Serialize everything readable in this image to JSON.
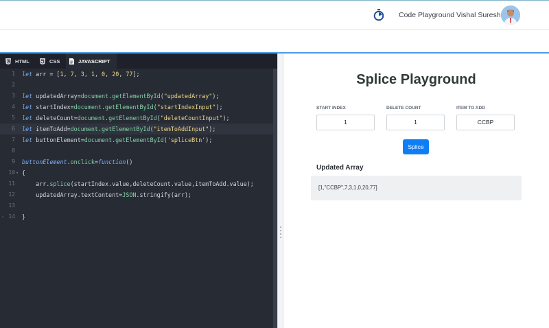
{
  "header": {
    "brand": "Code Playground",
    "user_name": "Vishal Suresh"
  },
  "editor": {
    "tabs": [
      {
        "label": "HTML",
        "icon": "html5-icon"
      },
      {
        "label": "CSS",
        "icon": "css3-icon"
      },
      {
        "label": "JAVASCRIPT",
        "icon": "js-file-icon",
        "active": true
      }
    ],
    "line_numbers": [
      "1",
      "2",
      "3",
      "4",
      "5",
      "6",
      "7",
      "8",
      "9",
      "10",
      "11",
      "12",
      "13",
      "14"
    ],
    "code": {
      "l1": [
        "let",
        " arr = [",
        "1",
        ", ",
        "7",
        ", ",
        "3",
        ", ",
        "1",
        ", ",
        "0",
        ", ",
        "20",
        ", ",
        "77",
        "];"
      ],
      "l3": [
        "let",
        " updatedArray=",
        "document",
        ".",
        "getElementById",
        "(",
        "\"updatedArray\"",
        ");"
      ],
      "l4": [
        "let",
        " startIndex=",
        "document",
        ".",
        "getElementById",
        "(",
        "\"startIndexInput\"",
        ");"
      ],
      "l5": [
        "let",
        " deleteCount=",
        "document",
        ".",
        "getElementById",
        "(",
        "\"deleteCountInput\"",
        ");"
      ],
      "l6": [
        "let",
        " itemToAdd=",
        "document",
        ".",
        "getElementById",
        "(",
        "\"itemToAddInput\"",
        ");"
      ],
      "l7": [
        "let",
        " buttonElement=",
        "document",
        ".",
        "getElementById",
        "(",
        "'spliceBtn'",
        ");"
      ],
      "l9": [
        "buttonElement",
        ".",
        "onclick",
        "=",
        "function",
        "()"
      ],
      "l10": [
        "{"
      ],
      "l11": [
        "    arr.",
        "splice",
        "(startIndex.value,deleteCount.value,itemToAdd.value);"
      ],
      "l12": [
        "    updatedArray.textContent=",
        "JSON",
        ".stringify(arr);"
      ],
      "l14": [
        "}"
      ]
    }
  },
  "preview": {
    "title": "Splice Playground",
    "fields": [
      {
        "label": "START INDEX",
        "value": "1"
      },
      {
        "label": "DELETE COUNT",
        "value": "1"
      },
      {
        "label": "ITEM TO ADD",
        "value": "CCBP"
      }
    ],
    "button_label": "Splice",
    "updated_heading": "Updated Array",
    "result": "[1,\"CCBP\",7,3,1,0,20,77]"
  },
  "colors": {
    "accent": "#0d7ef6",
    "editor_bg": "#272b34",
    "keyword": "#7fb3ff",
    "function": "#84d3a8",
    "string": "#f0d98a"
  }
}
